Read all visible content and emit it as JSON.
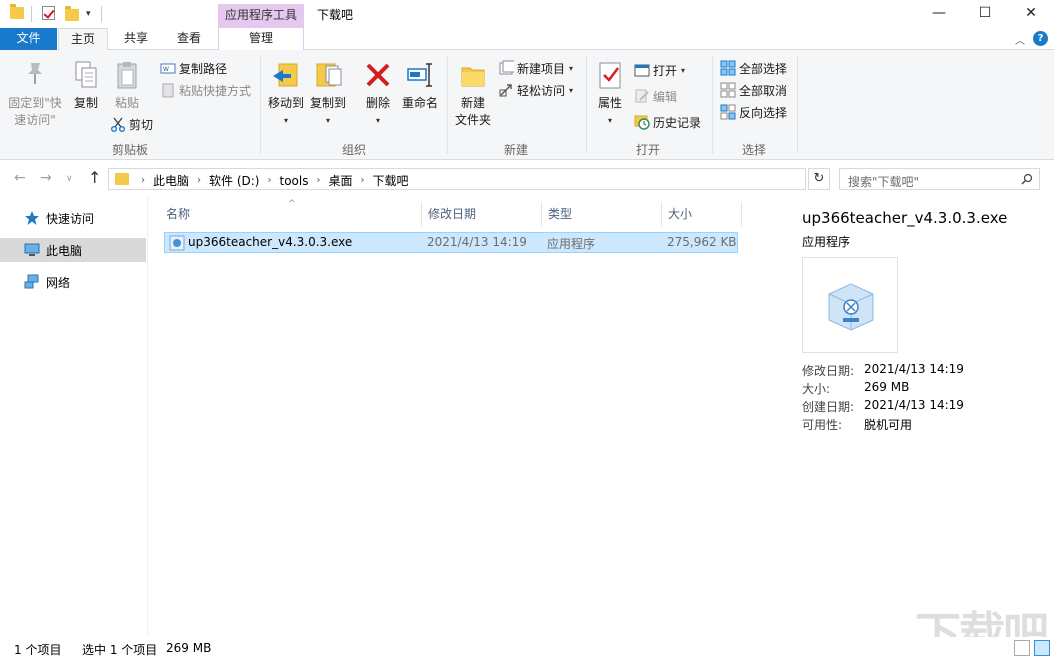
{
  "window": {
    "context_tab": "应用程序工具",
    "title": "下载吧",
    "minimize": "—",
    "maximize": "☐",
    "close": "✕"
  },
  "tabs": {
    "file": "文件",
    "home": "主页",
    "share": "共享",
    "view": "查看",
    "manage": "管理",
    "collapse": "︿",
    "help": "?"
  },
  "ribbon": {
    "clipboard": {
      "label": "剪贴板",
      "pin_line1": "固定到\"快",
      "pin_line2": "速访问\"",
      "copy": "复制",
      "paste": "粘贴",
      "copy_path": "复制路径",
      "paste_shortcut": "粘贴快捷方式",
      "cut": "剪切"
    },
    "organize": {
      "label": "组织",
      "move_to": "移动到",
      "copy_to": "复制到",
      "delete": "删除",
      "rename": "重命名"
    },
    "new": {
      "label": "新建",
      "new_folder_line1": "新建",
      "new_folder_line2": "文件夹",
      "new_item": "新建项目",
      "easy_access": "轻松访问"
    },
    "open": {
      "label": "打开",
      "properties": "属性",
      "open": "打开",
      "edit": "编辑",
      "history": "历史记录"
    },
    "select": {
      "label": "选择",
      "select_all": "全部选择",
      "select_none": "全部取消",
      "invert": "反向选择"
    }
  },
  "address": {
    "back": "←",
    "forward": "→",
    "recent": "∨",
    "up": "↑",
    "crumbs": [
      "此电脑",
      "软件 (D:)",
      "tools",
      "桌面",
      "下载吧"
    ],
    "dropdown": "∨",
    "refresh": "↻",
    "search_placeholder": "搜索\"下载吧\""
  },
  "nav_pane": {
    "quick_access": "快速访问",
    "this_pc": "此电脑",
    "network": "网络"
  },
  "columns": {
    "name": "名称",
    "date": "修改日期",
    "type": "类型",
    "size": "大小",
    "sort_indicator": "^"
  },
  "files": [
    {
      "name": "up366teacher_v4.3.0.3.exe",
      "date": "2021/4/13 14:19",
      "type": "应用程序",
      "size": "275,962 KB"
    }
  ],
  "details": {
    "name": "up366teacher_v4.3.0.3.exe",
    "type": "应用程序",
    "props": [
      {
        "label": "修改日期:",
        "value": "2021/4/13 14:19"
      },
      {
        "label": "大小:",
        "value": "269 MB"
      },
      {
        "label": "创建日期:",
        "value": "2021/4/13 14:19"
      },
      {
        "label": "可用性:",
        "value": "脱机可用"
      }
    ]
  },
  "status": {
    "item_count": "1 个项目",
    "selected": "选中 1 个项目",
    "selected_size": "269 MB"
  },
  "watermark": "下载吧",
  "colors": {
    "file_tab": "#1979ca",
    "context_tab": "#e4c8ee",
    "selection_fill": "#cce8ff",
    "selection_border": "#99d1ff",
    "folder_yellow": "#f5c94a"
  }
}
